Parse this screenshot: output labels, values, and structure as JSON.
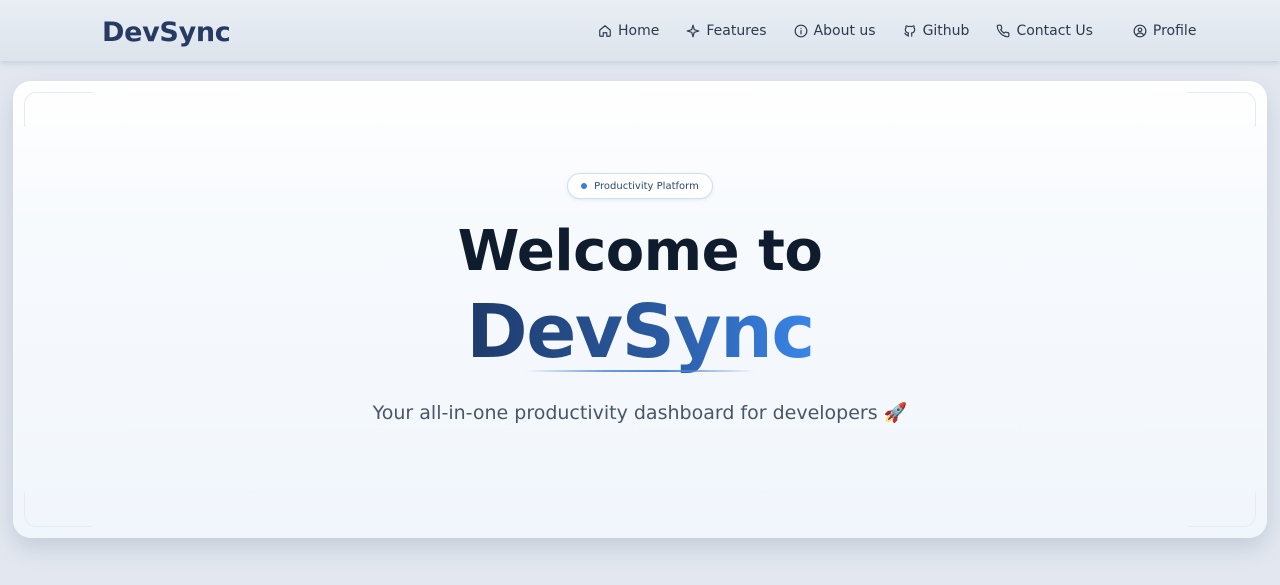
{
  "brand": {
    "name": "DevSync"
  },
  "nav": {
    "items": [
      {
        "label": "Home",
        "icon": "home-icon"
      },
      {
        "label": "Features",
        "icon": "sparkle-icon"
      },
      {
        "label": "About us",
        "icon": "info-icon"
      },
      {
        "label": "Github",
        "icon": "github-icon"
      },
      {
        "label": "Contact Us",
        "icon": "phone-icon"
      },
      {
        "label": "Profile",
        "icon": "user-circle-icon"
      }
    ]
  },
  "hero": {
    "badge": "Productivity Platform",
    "title_line1": "Welcome to",
    "title_line2": "DevSync",
    "subtitle": "Your all-in-one productivity dashboard for developers 🚀"
  },
  "colors": {
    "brand": "#263a63",
    "accent": "#3b7be0",
    "title": "#0f1c2e",
    "gradient_start": "#1e3a6a",
    "gradient_end": "#3a86ea"
  }
}
